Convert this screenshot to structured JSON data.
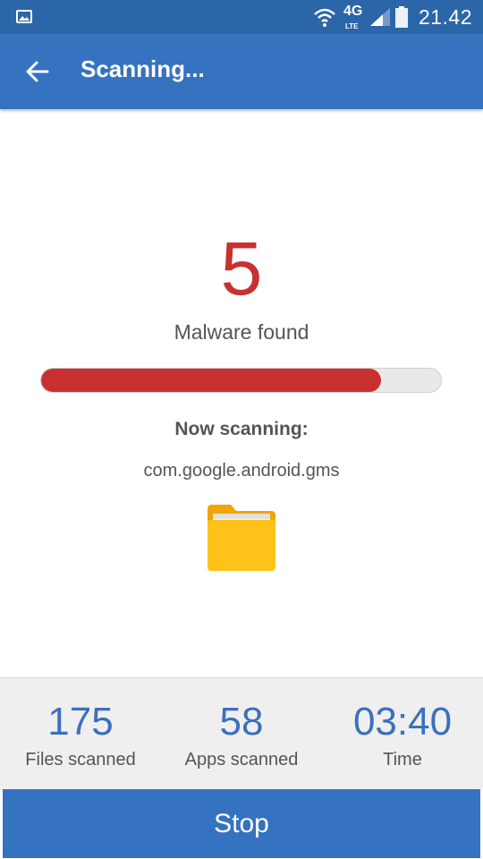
{
  "status_bar": {
    "network": "4G",
    "network_sub": "LTE",
    "time": "21.42"
  },
  "app_bar": {
    "title": "Scanning...",
    "back_icon": "arrow-back-icon"
  },
  "scan": {
    "malware_count": "5",
    "malware_label": "Malware found",
    "progress": 0.85,
    "progress_color": "#c8302f",
    "now_scanning_label": "Now scanning:",
    "current_package": "com.google.android.gms",
    "item_icon": "folder-icon"
  },
  "stats": [
    {
      "value": "175",
      "label": "Files scanned"
    },
    {
      "value": "58",
      "label": "Apps scanned"
    },
    {
      "value": "03:40",
      "label": "Time"
    }
  ],
  "stop_button": {
    "label": "Stop"
  },
  "colors": {
    "accent": "#3573c0",
    "alert": "#c8312f",
    "stat_value": "#3b70bb"
  }
}
